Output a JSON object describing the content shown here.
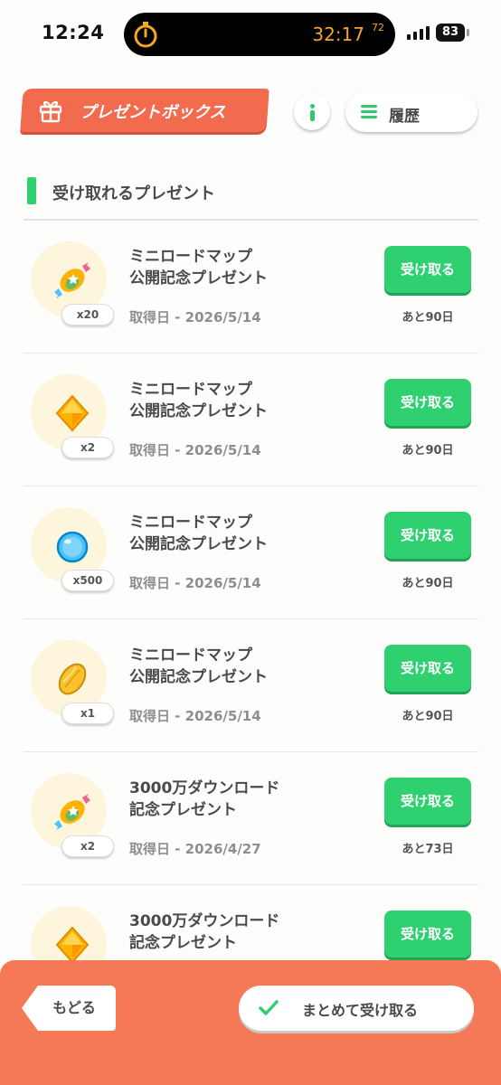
{
  "status_bar": {
    "time": "12:24",
    "timer": "32:17",
    "timer_fraction": "72",
    "battery": "83"
  },
  "header": {
    "title": "プレゼントボックス",
    "history_label": "履歴"
  },
  "section": {
    "title": "受け取れるプレゼント"
  },
  "presents": [
    {
      "title_line1": "ミニロードマップ",
      "title_line2": "公開記念プレゼント",
      "date": "取得日 - 2026/5/14",
      "quantity": "x20",
      "button": "受け取る",
      "remaining": "あと90日",
      "icon": "candy-icon"
    },
    {
      "title_line1": "ミニロードマップ",
      "title_line2": "公開記念プレゼント",
      "date": "取得日 - 2026/5/14",
      "quantity": "x2",
      "button": "受け取る",
      "remaining": "あと90日",
      "icon": "diamond-icon"
    },
    {
      "title_line1": "ミニロードマップ",
      "title_line2": "公開記念プレゼント",
      "date": "取得日 - 2026/5/14",
      "quantity": "x500",
      "button": "受け取る",
      "remaining": "あと90日",
      "icon": "orb-icon"
    },
    {
      "title_line1": "ミニロードマップ",
      "title_line2": "公開記念プレゼント",
      "date": "取得日 - 2026/5/14",
      "quantity": "x1",
      "button": "受け取る",
      "remaining": "あと90日",
      "icon": "seed-icon"
    },
    {
      "title_line1": "3000万ダウンロード",
      "title_line2": "記念プレゼント",
      "date": "取得日 - 2026/4/27",
      "quantity": "x2",
      "button": "受け取る",
      "remaining": "あと73日",
      "icon": "candy-icon"
    },
    {
      "title_line1": "3000万ダウンロード",
      "title_line2": "記念プレゼント",
      "button": "受け取る",
      "icon": "diamond-icon"
    }
  ],
  "footer": {
    "back_label": "もどる",
    "receive_all_label": "まとめて受け取る"
  }
}
